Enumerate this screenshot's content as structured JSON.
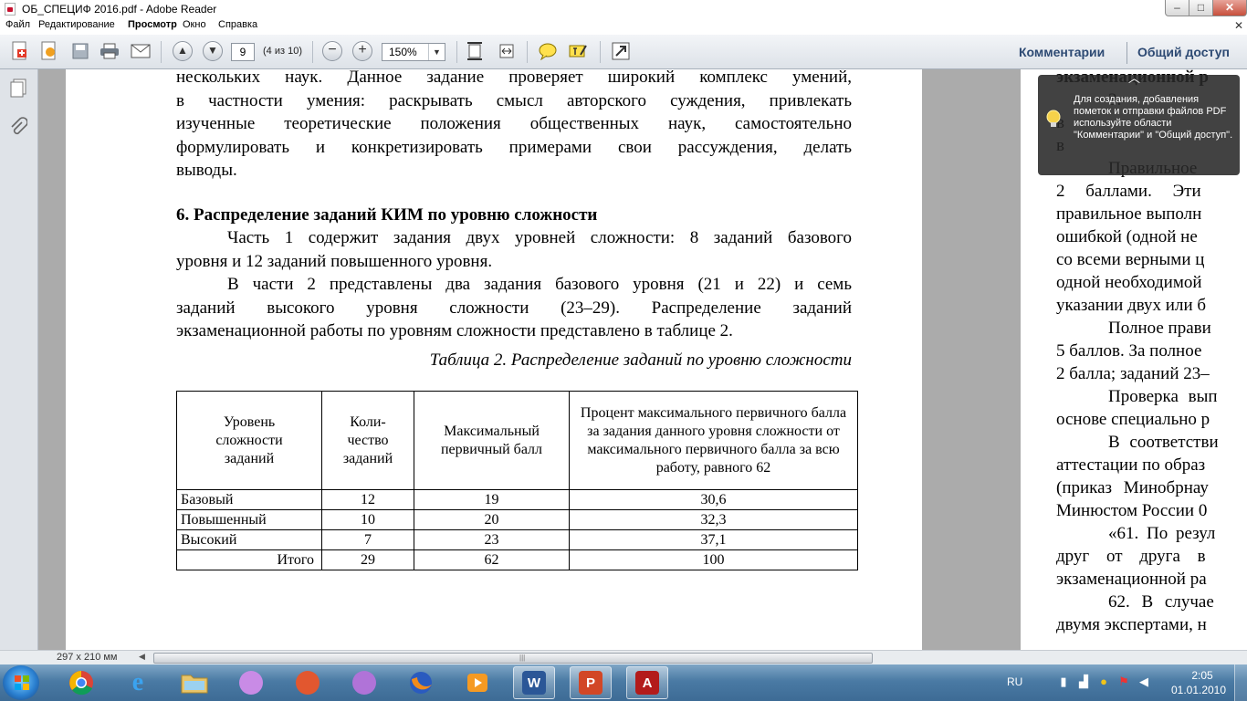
{
  "window": {
    "title": "ОБ_СПЕЦИФ 2016.pdf - Adobe Reader"
  },
  "menu": [
    "Файл",
    "Редактирование",
    "Просмотр",
    "Окно",
    "Справка"
  ],
  "toolbar": {
    "page_number": "9",
    "page_count": "(4 из 10)",
    "zoom": "150%",
    "comments": "Комментарии",
    "share": "Общий доступ"
  },
  "tooltip": {
    "text": "Для создания, добавления пометок и отправки файлов PDF используйте области \"Комментарии\" и \"Общий доступ\"."
  },
  "document": {
    "page1": {
      "para_top": [
        "нескольких наук. Данное задание проверяет широкий комплекс умений,",
        "в частности умения: раскрывать смысл авторского суждения, привлекать",
        "изученные теоретические положения общественных наук, самостоятельно",
        "формулировать и конкретизировать примерами свои рассуждения, делать",
        "выводы."
      ],
      "heading": "6. Распределение заданий КИМ по уровню сложности",
      "para_part1": [
        "Часть 1 содержит задания двух уровней сложности: 8 заданий базового",
        "уровня и 12 заданий повышенного уровня."
      ],
      "para_part2": [
        "В части 2 представлены два задания базового уровня (21 и 22) и семь",
        "заданий высокого уровня сложности (23–29). Распределение заданий",
        "экзаменационной работы по уровням сложности представлено в таблице 2."
      ],
      "table_caption": "Таблица 2. Распределение заданий по уровню сложности",
      "table": {
        "headers": [
          "Уровень сложности заданий",
          "Коли-чество заданий",
          "Максимальный первичный балл",
          "Процент максимального первичного балла за задания данного уровня сложности от максимального первичного балла за всю работу, равного 62"
        ],
        "rows": [
          [
            "Базовый",
            "12",
            "19",
            "30,6"
          ],
          [
            "Повышенный",
            "10",
            "20",
            "32,3"
          ],
          [
            "Высокий",
            "7",
            "23",
            "37,1"
          ],
          [
            "Итого",
            "29",
            "62",
            "100"
          ]
        ]
      }
    },
    "page2": {
      "lines": [
        "экзаменационной р",
        "3.",
        "в",
        "в",
        "Правильное",
        "2 баллами. Эти",
        "правильное выполн",
        "ошибкой (одной не",
        "со всеми верными ц",
        "одной необходимой",
        "указании двух или б",
        "Полное прави",
        "5 баллов. За полное",
        "2 балла; заданий 23–",
        "Проверка вып",
        "основе специально р",
        "В соответстви",
        "аттестации по образ",
        "(приказ Минобрнау",
        "Минюстом России 0",
        "«61. По резул",
        "друг от друга в",
        "экзаменационной ра",
        "62. В случае",
        "двумя экспертами, н"
      ]
    }
  },
  "status": {
    "page_size": "297 x 210 мм"
  },
  "taskbar": {
    "language": "RU",
    "time": "2:05",
    "date": "01.01.2010"
  }
}
